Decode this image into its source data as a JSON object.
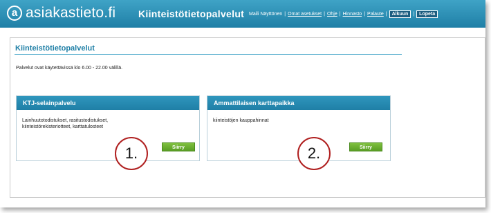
{
  "header": {
    "logo_text": "asiakastieto.fi",
    "logo_icon": "asiakastieto-logo-icon",
    "service_title": "Kiinteistötietopalvelut",
    "user_name": "Maili Näyttönen",
    "links": [
      "Omat asetukset",
      "Ohje",
      "Hinnasto",
      "Palaute"
    ],
    "home_button": "Alkuun",
    "logout_button": "Lopeta"
  },
  "page": {
    "title": "Kiinteistötietopalvelut",
    "availability": "Palvelut ovat käytettävissä klo 6.00 - 22.00 välillä."
  },
  "cards": [
    {
      "title": "KTJ-selainpalvelu",
      "description": "Lainhuutotodistukset, rasitustodistukset, kiinteistörekisteriotteet, karttatulosteet",
      "button": "Siirry",
      "step": "1."
    },
    {
      "title": "Ammattilaisen karttapaikka",
      "description": "kiinteistöjen kauppahinnat",
      "button": "Siirry",
      "step": "2."
    }
  ],
  "colors": {
    "header_blue": "#1f7fa6",
    "accent_light_blue": "#3fa3c6",
    "button_green": "#5a9e25",
    "marker_red": "#b02020"
  }
}
